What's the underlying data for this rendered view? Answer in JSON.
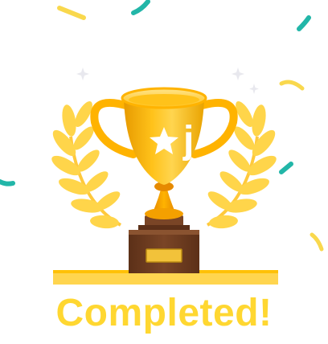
{
  "status": {
    "title": "Completed!"
  },
  "trophy": {
    "badge_letter": "j",
    "icons": [
      "star-icon",
      "trophy-icon",
      "laurel-wreath-icon",
      "confetti",
      "sparkle-icon"
    ]
  },
  "colors": {
    "gold": "#FFC107",
    "gold_light": "#FFD54F",
    "gold_dark": "#E89A00",
    "laurel": "#FFD54A",
    "base_brown": "#6D3C20",
    "teal_confetti": "#22B6A8",
    "yellow_confetti": "#F9D84D",
    "title": "#FFD731"
  }
}
